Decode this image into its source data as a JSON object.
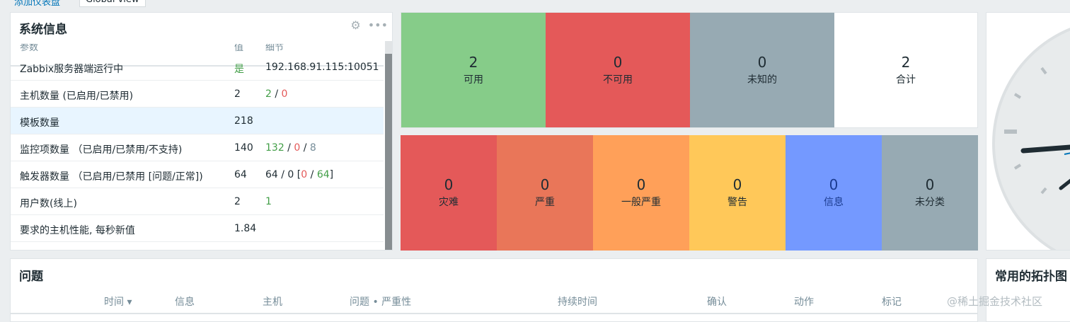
{
  "breadcrumb": {
    "first": "添加仪表盘",
    "second": "Global view"
  },
  "system_info": {
    "title": "系统信息",
    "headers": {
      "param": "参数",
      "value": "值",
      "details": "细节"
    },
    "rows": [
      {
        "param": "Zabbix服务器端运行中",
        "value": "是",
        "details": "192.168.91.115:10051"
      },
      {
        "param": "主机数量 (已启用/已禁用)",
        "value": "2",
        "d1": "2",
        "sep1": " / ",
        "d2": "0"
      },
      {
        "param": "模板数量",
        "value": "218"
      },
      {
        "param": "监控项数量 （已启用/已禁用/不支持)",
        "value": "140",
        "d1": "132",
        "sep1": " / ",
        "d2": "0",
        "sep2": " / ",
        "d3": "8"
      },
      {
        "param": "触发器数量 （已启用/已禁用 [问题/正常])",
        "value": "64",
        "d0": "64 / 0 [",
        "d1": "0",
        "sep1": " / ",
        "d2": "64",
        "d3": "]"
      },
      {
        "param": "用户数(线上)",
        "value": "2",
        "d1": "1"
      },
      {
        "param": "要求的主机性能, 每秒新值",
        "value": "1.84"
      }
    ]
  },
  "host_availability": [
    {
      "count": "2",
      "label": "可用",
      "color": "#86cc89"
    },
    {
      "count": "0",
      "label": "不可用",
      "color": "#e45959"
    },
    {
      "count": "0",
      "label": "未知的",
      "color": "#97aab3"
    },
    {
      "count": "2",
      "label": "合计",
      "color": "#ffffff"
    }
  ],
  "severity": [
    {
      "count": "0",
      "label": "灾难",
      "color": "#e45959"
    },
    {
      "count": "0",
      "label": "严重",
      "color": "#e97659"
    },
    {
      "count": "0",
      "label": "一般严重",
      "color": "#ffa059"
    },
    {
      "count": "0",
      "label": "警告",
      "color": "#ffc859"
    },
    {
      "count": "0",
      "label": "信息",
      "color": "#7499ff"
    },
    {
      "count": "0",
      "label": "未分类",
      "color": "#97aab3"
    }
  ],
  "problems": {
    "title": "问题",
    "columns": [
      "时间 ▾",
      "信息",
      "主机",
      "问题 • 严重性",
      "持续时间",
      "确认",
      "动作",
      "标记"
    ]
  },
  "maps": {
    "title": "常用的拓扑图"
  },
  "watermark": "@稀土掘金技术社区",
  "icons": {
    "settings": "gear-icon",
    "menu": "more-icon"
  }
}
